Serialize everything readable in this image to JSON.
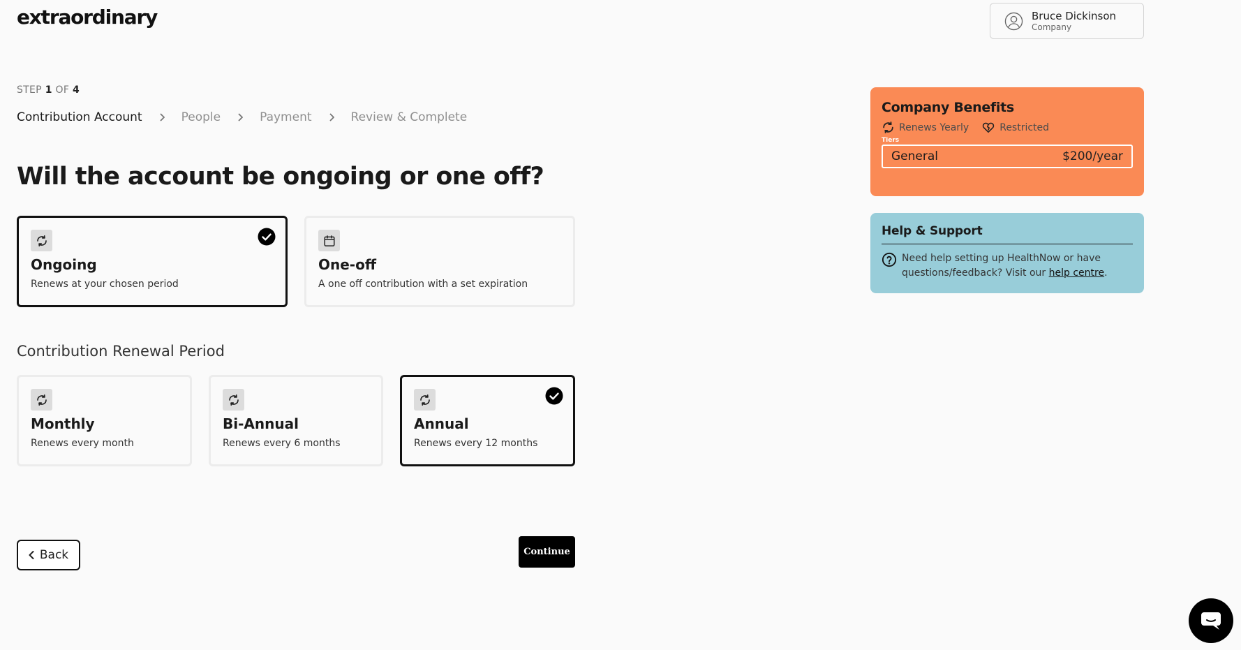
{
  "brand": {
    "logo": "extraordinary"
  },
  "user": {
    "name": "Bruce Dickinson",
    "role": "Company"
  },
  "step": {
    "prefix": "STEP",
    "current": "1",
    "of": "OF",
    "total": "4"
  },
  "breadcrumb": [
    {
      "label": "Contribution Account",
      "active": true
    },
    {
      "label": "People",
      "active": false
    },
    {
      "label": "Payment",
      "active": false
    },
    {
      "label": "Review & Complete",
      "active": false
    }
  ],
  "question": "Will the account be ongoing or one off?",
  "type_options": [
    {
      "title": "Ongoing",
      "desc": "Renews at your chosen period",
      "icon": "refresh-icon",
      "selected": true
    },
    {
      "title": "One-off",
      "desc": "A one off contribution with a set expiration",
      "icon": "calendar-icon",
      "selected": false
    }
  ],
  "renewal": {
    "label": "Contribution Renewal Period",
    "options": [
      {
        "title": "Monthly",
        "desc": "Renews every month",
        "icon": "refresh-icon",
        "selected": false
      },
      {
        "title": "Bi-Annual",
        "desc": "Renews every 6 months",
        "icon": "refresh-icon",
        "selected": false
      },
      {
        "title": "Annual",
        "desc": "Renews every 12 months",
        "icon": "refresh-icon",
        "selected": true
      }
    ]
  },
  "actions": {
    "back": "Back",
    "continue": "Continue"
  },
  "benefits": {
    "title": "Company Benefits",
    "tags": [
      {
        "label": "Renews Yearly",
        "icon": "refresh-icon"
      },
      {
        "label": "Restricted",
        "icon": "broken-heart-icon"
      }
    ],
    "tiers_label": "Tiers",
    "tier": {
      "name": "General",
      "price": "$200/year"
    },
    "color": "#fa8a55"
  },
  "support": {
    "title": "Help & Support",
    "text_before": "Need help setting up HealthNow or have questions/feedback? Visit our ",
    "link": "help centre",
    "text_after": ".",
    "color": "#98cdd9"
  }
}
